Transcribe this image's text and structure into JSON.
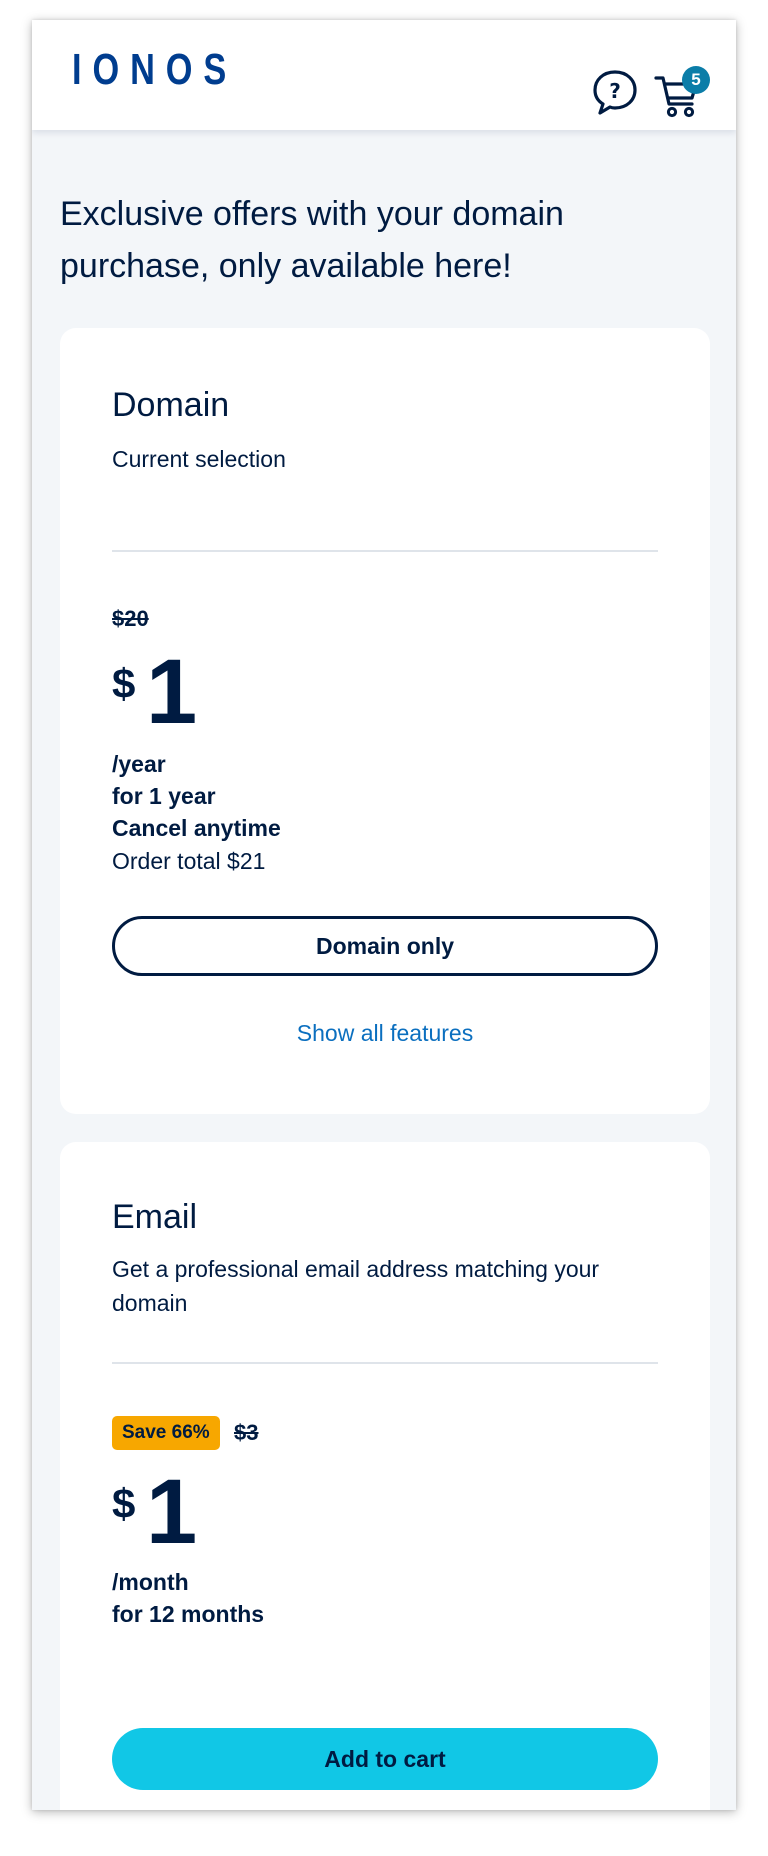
{
  "header": {
    "logo_text": "IONOS",
    "help_icon": "speech-bubble-question-icon",
    "cart_icon": "shopping-cart-icon",
    "cart_count": "5"
  },
  "headline": "Exclusive offers with your domain purchase, only available here!",
  "cards": [
    {
      "title": "Domain",
      "subtitle": "Current selection",
      "old_price": "$20",
      "currency": "$",
      "price": "1",
      "term_lines": [
        "/year",
        "for 1 year",
        "Cancel anytime"
      ],
      "order_total": "Order total $21",
      "button_label": "Domain only",
      "link_label": "Show all features"
    },
    {
      "title": "Email",
      "subtitle": "Get a professional email address matching your domain",
      "badge": "Save 66%",
      "old_price": "$3",
      "currency": "$",
      "price": "1",
      "term_lines": [
        "/month",
        "for 12 months"
      ],
      "button_label": "Add to cart"
    }
  ],
  "colors": {
    "navy": "#001b41",
    "brand_blue": "#003d8f",
    "cta_cyan": "#11c7e6",
    "badge_orange": "#f7a700",
    "link_blue": "#0b6fbf",
    "page_bg": "#f3f6f9"
  }
}
